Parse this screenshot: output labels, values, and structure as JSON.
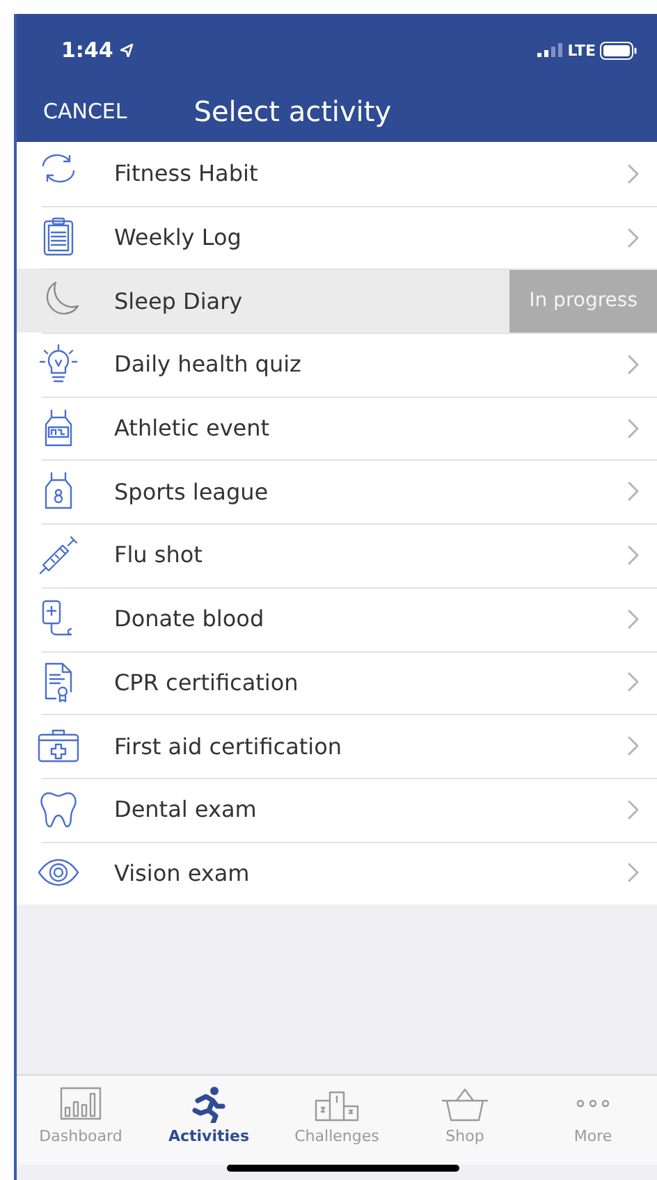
{
  "status_bar": {
    "time": "1:44",
    "network": "LTE"
  },
  "nav": {
    "cancel": "CANCEL",
    "title": "Select activity"
  },
  "activities": [
    {
      "kind": "cycle",
      "label": "Fitness Habit",
      "active": false
    },
    {
      "kind": "clipboard",
      "label": "Weekly Log",
      "active": false
    },
    {
      "kind": "moon",
      "label": "Sleep Diary",
      "active": true,
      "badge": "In progress"
    },
    {
      "kind": "bulb",
      "label": "Daily health quiz",
      "active": false
    },
    {
      "kind": "bib",
      "label": "Athletic event",
      "active": false
    },
    {
      "kind": "jersey",
      "label": "Sports league",
      "active": false
    },
    {
      "kind": "syringe",
      "label": "Flu shot",
      "active": false
    },
    {
      "kind": "bag",
      "label": "Donate blood",
      "active": false
    },
    {
      "kind": "certificate",
      "label": "CPR certification",
      "active": false
    },
    {
      "kind": "kit",
      "label": "First aid certification",
      "active": false
    },
    {
      "kind": "tooth",
      "label": "Dental exam",
      "active": false
    },
    {
      "kind": "eye",
      "label": "Vision exam",
      "active": false
    }
  ],
  "tabs": [
    {
      "kind": "chart",
      "label": "Dashboard",
      "selected": false
    },
    {
      "kind": "runner",
      "label": "Activities",
      "selected": true
    },
    {
      "kind": "podium",
      "label": "Challenges",
      "selected": false
    },
    {
      "kind": "basket",
      "label": "Shop",
      "selected": false
    },
    {
      "kind": "dots",
      "label": "More",
      "selected": false
    }
  ]
}
